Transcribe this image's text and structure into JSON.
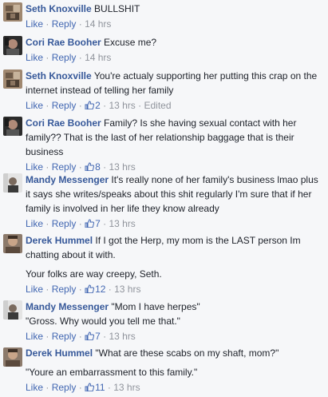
{
  "actions": {
    "like": "Like",
    "reply": "Reply",
    "dot": "·"
  },
  "comments": [
    {
      "author": "Seth Knoxville",
      "text": "BULLSHIT",
      "likes": "",
      "time": "14 hrs",
      "edited": ""
    },
    {
      "author": "Cori Rae Booher",
      "text": "Excuse me?",
      "likes": "",
      "time": "14 hrs",
      "edited": ""
    },
    {
      "author": "Seth Knoxville",
      "text": "You're actualy supporting her putting this crap on the internet instead of telling her family",
      "likes": "2",
      "time": "13 hrs",
      "edited": "Edited"
    },
    {
      "author": "Cori Rae Booher",
      "text": "Family? Is she having sexual contact with her family?? That is the last of her relationship baggage that is their business",
      "likes": "8",
      "time": "13 hrs",
      "edited": ""
    },
    {
      "author": "Mandy Messenger",
      "text": "It's really none of her family's business lmao plus it says she writes/speaks about this shit regularly I'm sure that if her family is involved in her life they know already",
      "likes": "7",
      "time": "13 hrs",
      "edited": ""
    },
    {
      "author": "Derek Hummel",
      "text": "If I got the Herp, my mom is the LAST person Im chatting about it with.",
      "text2": "Your folks are way creepy, Seth.",
      "likes": "12",
      "time": "13 hrs",
      "edited": ""
    },
    {
      "author": "Mandy Messenger",
      "text": "\"Mom I have herpes\"",
      "text2": "\"Gross. Why would you tell me that.\"",
      "likes": "7",
      "time": "13 hrs",
      "edited": ""
    },
    {
      "author": "Derek Hummel",
      "text": "\"What are these scabs on my shaft, mom?\"",
      "text2": "\"Youre an embarrassment to this family.\"",
      "likes": "11",
      "time": "13 hrs",
      "edited": ""
    }
  ]
}
